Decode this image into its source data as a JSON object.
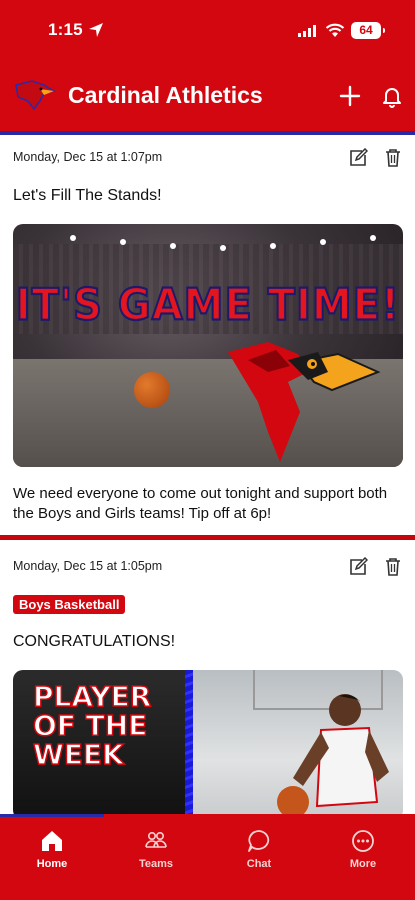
{
  "status_bar": {
    "time": "1:15",
    "battery": "64"
  },
  "header": {
    "title": "Cardinal Athletics"
  },
  "posts": [
    {
      "date": "Monday, Dec 15 at 1:07pm",
      "title": "Let's Fill The Stands!",
      "image_headline": "IT'S GAME TIME!",
      "body": "We need everyone to come out tonight and support both the Boys and Girls teams! Tip off at 6p!"
    },
    {
      "date": "Monday, Dec 15 at 1:05pm",
      "tag": "Boys Basketball",
      "title": "CONGRATULATIONS!",
      "image_text": [
        "PLAYER",
        "OF THE",
        "WEEK"
      ]
    }
  ],
  "tabs": [
    {
      "label": "Home",
      "icon": "home-icon",
      "active": true
    },
    {
      "label": "Teams",
      "icon": "teams-icon",
      "active": false
    },
    {
      "label": "Chat",
      "icon": "chat-icon",
      "active": false
    },
    {
      "label": "More",
      "icon": "more-icon",
      "active": false
    }
  ],
  "colors": {
    "primary": "#d2070f",
    "accent_blue": "#2a2aa8"
  }
}
